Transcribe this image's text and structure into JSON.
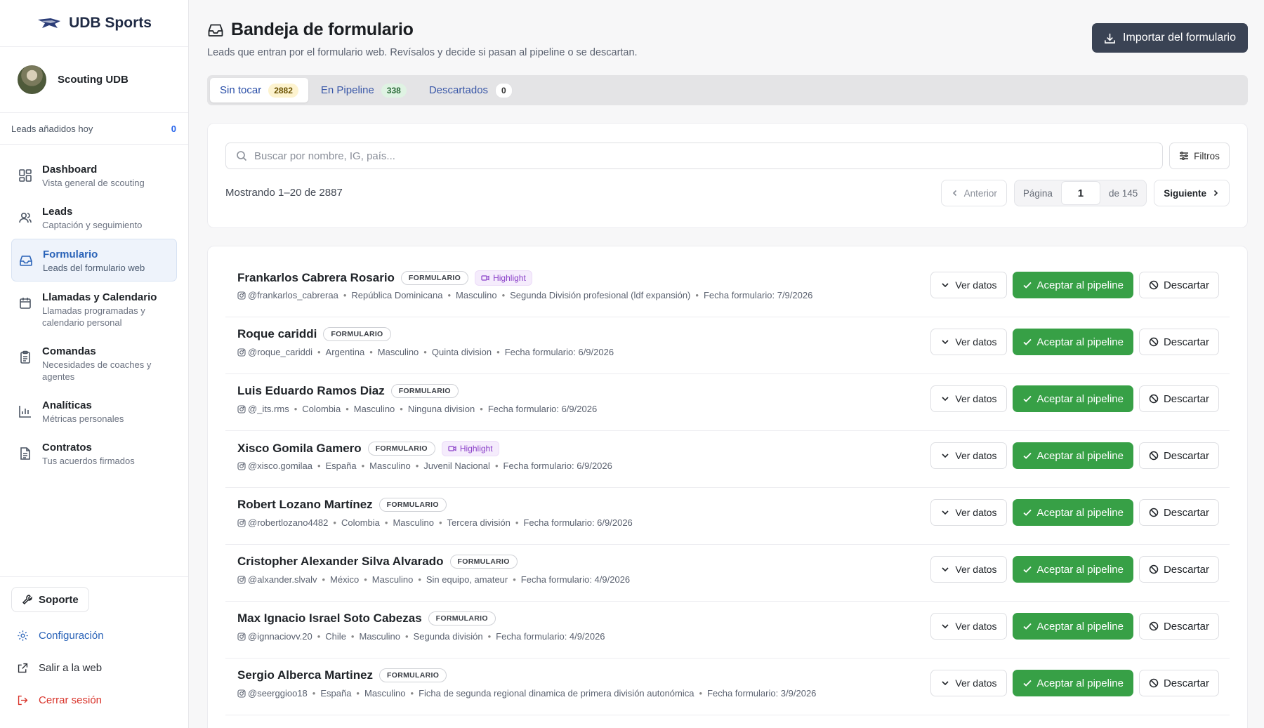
{
  "brand": {
    "name": "UDB Sports"
  },
  "user": {
    "name": "Scouting UDB"
  },
  "today": {
    "label": "Leads añadidos hoy",
    "count": "0"
  },
  "nav": [
    {
      "title": "Dashboard",
      "sub": "Vista general de scouting",
      "icon": "dashboard-icon"
    },
    {
      "title": "Leads",
      "sub": "Captación y seguimiento",
      "icon": "users-icon"
    },
    {
      "title": "Formulario",
      "sub": "Leads del formulario web",
      "icon": "inbox-icon"
    },
    {
      "title": "Llamadas y Calendario",
      "sub": "Llamadas programadas y calendario personal",
      "icon": "calendar-icon"
    },
    {
      "title": "Comandas",
      "sub": "Necesidades de coaches y agentes",
      "icon": "clipboard-icon"
    },
    {
      "title": "Analíticas",
      "sub": "Métricas personales",
      "icon": "chart-icon"
    },
    {
      "title": "Contratos",
      "sub": "Tus acuerdos firmados",
      "icon": "document-icon"
    }
  ],
  "bottom": {
    "support": "Soporte",
    "config": "Configuración",
    "web": "Salir a la web",
    "logout": "Cerrar sesión"
  },
  "page": {
    "title": "Bandeja de formulario",
    "subtitle": "Leads que entran por el formulario web. Revísalos y decide si pasan al pipeline o se descartan.",
    "import_label": "Importar del formulario"
  },
  "tabs": [
    {
      "label": "Sin tocar",
      "count": "2882"
    },
    {
      "label": "En Pipeline",
      "count": "338"
    },
    {
      "label": "Descartados",
      "count": "0"
    }
  ],
  "search": {
    "placeholder": "Buscar por nombre, IG, país...",
    "filters_label": "Filtros"
  },
  "pagination": {
    "showing": "Mostrando 1–20 de 2887",
    "prev": "Anterior",
    "page_label": "Página",
    "page": "1",
    "of": "de 145",
    "next": "Siguiente"
  },
  "row_labels": {
    "form_badge": "FORMULARIO",
    "highlight": "Highlight",
    "view": "Ver datos",
    "accept": "Aceptar al pipeline",
    "discard": "Descartar"
  },
  "leads": [
    {
      "name": "Frankarlos Cabrera Rosario",
      "highlight": true,
      "ig": "@frankarlos_cabreraa",
      "country": "República Dominicana",
      "gender": "Masculino",
      "level": "Segunda División profesional (ldf expansión)",
      "date": "Fecha formulario: 7/9/2026"
    },
    {
      "name": "Roque cariddi",
      "highlight": false,
      "ig": "@roque_cariddi",
      "country": "Argentina",
      "gender": "Masculino",
      "level": "Quinta division",
      "date": "Fecha formulario: 6/9/2026"
    },
    {
      "name": "Luis Eduardo Ramos Diaz",
      "highlight": false,
      "ig": "@_its.rms",
      "country": "Colombia",
      "gender": "Masculino",
      "level": "Ninguna division",
      "date": "Fecha formulario: 6/9/2026"
    },
    {
      "name": "Xisco Gomila Gamero",
      "highlight": true,
      "ig": "@xisco.gomilaa",
      "country": "España",
      "gender": "Masculino",
      "level": "Juvenil Nacional",
      "date": "Fecha formulario: 6/9/2026"
    },
    {
      "name": "Robert Lozano Martínez",
      "highlight": false,
      "ig": "@robertlozano4482",
      "country": "Colombia",
      "gender": "Masculino",
      "level": "Tercera división",
      "date": "Fecha formulario: 6/9/2026"
    },
    {
      "name": "Cristopher Alexander Silva Alvarado",
      "highlight": false,
      "ig": "@alxander.slvalv",
      "country": "México",
      "gender": "Masculino",
      "level": "Sin equipo, amateur",
      "date": "Fecha formulario: 4/9/2026"
    },
    {
      "name": "Max Ignacio Israel Soto Cabezas",
      "highlight": false,
      "ig": "@ignnaciovv.20",
      "country": "Chile",
      "gender": "Masculino",
      "level": "Segunda división",
      "date": "Fecha formulario: 4/9/2026"
    },
    {
      "name": "Sergio Alberca Martinez",
      "highlight": false,
      "ig": "@seerggioo18",
      "country": "España",
      "gender": "Masculino",
      "level": "Ficha de segunda regional dinamica de primera división autonómica",
      "date": "Fecha formulario: 3/9/2026"
    }
  ]
}
